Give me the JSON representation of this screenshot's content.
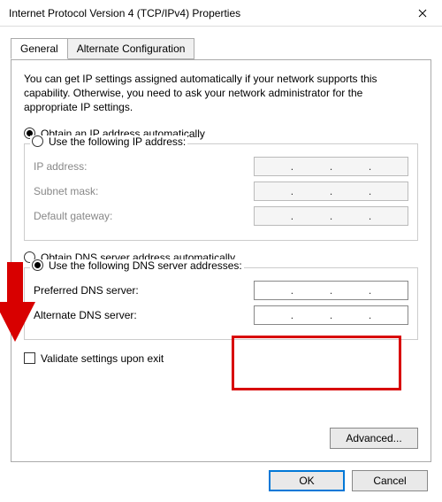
{
  "window": {
    "title": "Internet Protocol Version 4 (TCP/IPv4) Properties"
  },
  "tabs": {
    "general": "General",
    "alternate": "Alternate Configuration"
  },
  "description": "You can get IP settings assigned automatically if your network supports this capability. Otherwise, you need to ask your network administrator for the appropriate IP settings.",
  "ip": {
    "auto_label": "Obtain an IP address automatically",
    "manual_label": "Use the following IP address:",
    "ip_label": "IP address:",
    "subnet_label": "Subnet mask:",
    "gateway_label": "Default gateway:"
  },
  "dns": {
    "auto_label": "Obtain DNS server address automatically",
    "manual_label": "Use the following DNS server addresses:",
    "preferred_label": "Preferred DNS server:",
    "alternate_label": "Alternate DNS server:"
  },
  "validate_label": "Validate settings upon exit",
  "buttons": {
    "advanced": "Advanced...",
    "ok": "OK",
    "cancel": "Cancel"
  }
}
